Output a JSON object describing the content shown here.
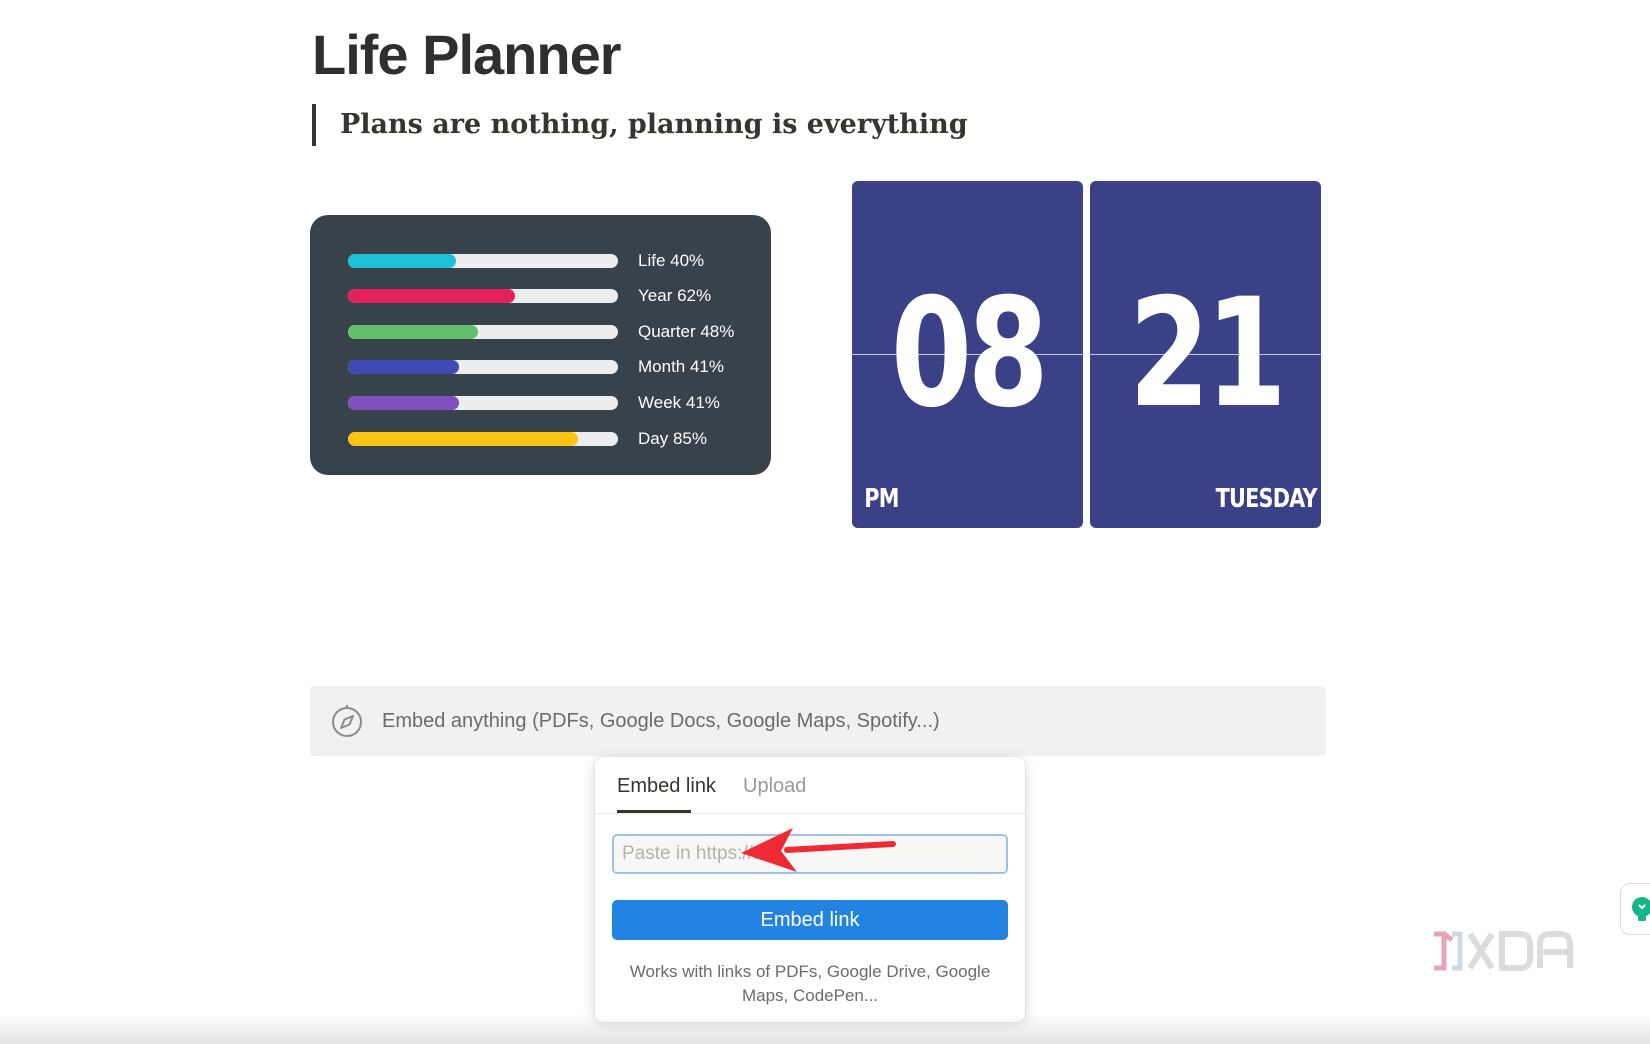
{
  "page": {
    "title": "Life Planner",
    "quote": "Plans are nothing, planning is everything"
  },
  "progress": [
    {
      "label": "Life 40%",
      "fraction": 0.4,
      "color": "#1fc0da"
    },
    {
      "label": "Year 62%",
      "fraction": 0.62,
      "color": "#e5215d"
    },
    {
      "label": "Quarter 48%",
      "fraction": 0.48,
      "color": "#62bf6c"
    },
    {
      "label": "Month 41%",
      "fraction": 0.41,
      "color": "#3f4bb4"
    },
    {
      "label": "Week 41%",
      "fraction": 0.41,
      "color": "#7e4fbd"
    },
    {
      "label": "Day 85%",
      "fraction": 0.85,
      "color": "#fbc312"
    }
  ],
  "clock": {
    "hour": "08",
    "minute": "21",
    "meridiem": "PM",
    "weekday": "TUESDAY",
    "card_color": "#3a4187"
  },
  "embed": {
    "block_text": "Embed anything (PDFs, Google Docs, Google Maps, Spotify...)",
    "icon": "compass-icon",
    "tabs": [
      {
        "label": "Embed link",
        "active": true
      },
      {
        "label": "Upload",
        "active": false
      }
    ],
    "input_placeholder": "Paste in https://...",
    "button_label": "Embed link",
    "help_text": "Works with links of PDFs, Google Drive, Google Maps, CodePen...",
    "button_color": "#2383e2"
  },
  "watermark": {
    "logo": "XDA"
  }
}
